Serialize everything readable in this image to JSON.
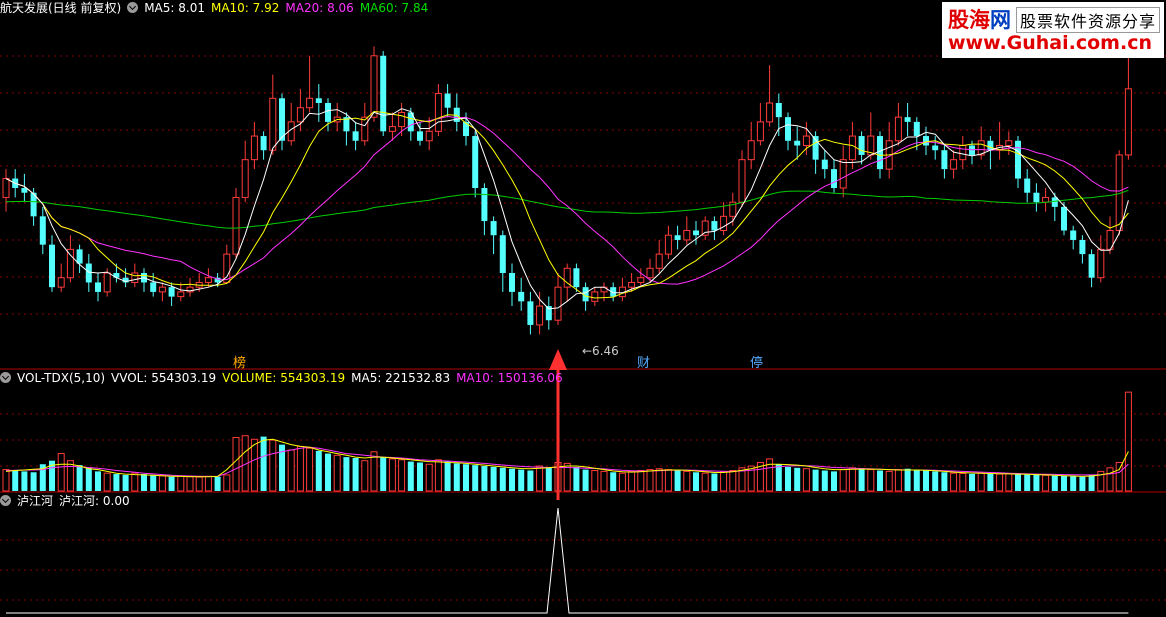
{
  "header_main": {
    "stock_title": "航天发展(日线 前复权)",
    "ma5": "MA5: 8.01",
    "ma10": "MA10: 7.92",
    "ma20": "MA20: 8.06",
    "ma60": "MA60: 7.84"
  },
  "header_volume": {
    "indicator": "VOL-TDX(5,10)",
    "vvol": "VVOL: 554303.19",
    "volume": "VOLUME: 554303.19",
    "ma5": "MA5: 221532.83",
    "ma10": "MA10: 150136.06"
  },
  "header_signal": {
    "indicator": "泸江河",
    "value": "泸江河: 0.00"
  },
  "logo": {
    "name_a": "股海",
    "name_b": "网",
    "slogan": "股票软件资源分享",
    "url": "www.Guhai.com.cn"
  },
  "markers": {
    "bang": "榜",
    "cai": "财",
    "ting": "停",
    "low_price": "←6.46"
  },
  "colors": {
    "up": "#ff3b3b",
    "down": "#54ffff",
    "ma5": "#ffffff",
    "ma10": "#ffff00",
    "ma20": "#ff33ff",
    "ma60": "#00cc00",
    "grid": "#880000",
    "arrow": "#ff3030"
  },
  "chart_data": [
    {
      "type": "candlestick",
      "title": "航天发展(日线 前复权)",
      "low_marker": 6.46,
      "series": [
        {
          "name": "MA5",
          "value": 8.01
        },
        {
          "name": "MA10",
          "value": 7.92
        },
        {
          "name": "MA20",
          "value": 8.06
        },
        {
          "name": "MA60",
          "value": 7.84
        }
      ],
      "candles": [
        [
          7.9,
          8.1,
          8.2,
          7.75
        ],
        [
          8.1,
          8.0,
          8.2,
          7.9
        ],
        [
          8.0,
          7.95,
          8.15,
          7.85
        ],
        [
          7.95,
          7.7,
          8.0,
          7.6
        ],
        [
          7.7,
          7.4,
          7.8,
          7.3
        ],
        [
          7.4,
          6.95,
          7.5,
          6.9
        ],
        [
          6.95,
          7.05,
          7.2,
          6.9
        ],
        [
          7.05,
          7.35,
          7.5,
          7.0
        ],
        [
          7.35,
          7.2,
          7.4,
          7.1
        ],
        [
          7.2,
          7.0,
          7.3,
          6.9
        ],
        [
          7.0,
          6.9,
          7.1,
          6.8
        ],
        [
          6.9,
          7.1,
          7.15,
          6.85
        ],
        [
          7.1,
          7.05,
          7.2,
          7.0
        ],
        [
          7.05,
          7.0,
          7.15,
          6.95
        ],
        [
          7.0,
          7.1,
          7.2,
          6.95
        ],
        [
          7.1,
          7.0,
          7.15,
          6.9
        ],
        [
          7.0,
          6.9,
          7.1,
          6.85
        ],
        [
          6.9,
          6.95,
          7.0,
          6.8
        ],
        [
          6.95,
          6.85,
          7.0,
          6.75
        ],
        [
          6.85,
          6.9,
          7.0,
          6.8
        ],
        [
          6.9,
          6.95,
          7.05,
          6.85
        ],
        [
          6.95,
          7.0,
          7.1,
          6.9
        ],
        [
          7.0,
          7.05,
          7.15,
          6.95
        ],
        [
          7.05,
          7.0,
          7.1,
          6.95
        ],
        [
          7.0,
          7.3,
          7.4,
          7.0
        ],
        [
          7.3,
          7.9,
          8.0,
          7.25
        ],
        [
          7.9,
          8.3,
          8.5,
          7.85
        ],
        [
          8.3,
          8.55,
          8.7,
          8.2
        ],
        [
          8.55,
          8.4,
          8.6,
          8.3
        ],
        [
          8.4,
          8.95,
          9.2,
          8.35
        ],
        [
          8.95,
          8.5,
          9.0,
          8.4
        ],
        [
          8.5,
          8.7,
          8.9,
          8.45
        ],
        [
          8.7,
          8.85,
          9.05,
          8.6
        ],
        [
          8.85,
          8.95,
          9.4,
          8.8
        ],
        [
          8.95,
          8.9,
          9.1,
          8.7
        ],
        [
          8.9,
          8.7,
          8.95,
          8.6
        ],
        [
          8.7,
          8.75,
          8.9,
          8.6
        ],
        [
          8.75,
          8.6,
          8.8,
          8.45
        ],
        [
          8.6,
          8.5,
          8.7,
          8.4
        ],
        [
          8.5,
          8.75,
          8.9,
          8.45
        ],
        [
          8.75,
          9.4,
          9.5,
          8.7
        ],
        [
          9.4,
          8.6,
          9.45,
          8.55
        ],
        [
          8.6,
          8.65,
          8.8,
          8.5
        ],
        [
          8.65,
          8.8,
          8.9,
          8.55
        ],
        [
          8.8,
          8.6,
          8.85,
          8.5
        ],
        [
          8.6,
          8.5,
          8.7,
          8.45
        ],
        [
          8.5,
          8.6,
          8.75,
          8.4
        ],
        [
          8.6,
          9.0,
          9.1,
          8.55
        ],
        [
          9.0,
          8.85,
          9.1,
          8.75
        ],
        [
          8.85,
          8.7,
          9.0,
          8.6
        ],
        [
          8.7,
          8.55,
          8.8,
          8.45
        ],
        [
          8.55,
          8.0,
          8.6,
          7.9
        ],
        [
          8.0,
          7.65,
          8.05,
          7.5
        ],
        [
          7.65,
          7.5,
          7.7,
          7.3
        ],
        [
          7.5,
          7.1,
          7.55,
          6.9
        ],
        [
          7.1,
          6.9,
          7.2,
          6.75
        ],
        [
          6.9,
          6.8,
          7.05,
          6.7
        ],
        [
          6.8,
          6.55,
          6.9,
          6.45
        ],
        [
          6.55,
          6.75,
          6.9,
          6.45
        ],
        [
          6.75,
          6.6,
          6.85,
          6.5
        ],
        [
          6.6,
          6.95,
          7.1,
          6.55
        ],
        [
          6.95,
          7.15,
          7.2,
          6.8
        ],
        [
          7.15,
          6.95,
          7.2,
          6.9
        ],
        [
          6.95,
          6.8,
          7.0,
          6.7
        ],
        [
          6.8,
          6.9,
          6.95,
          6.75
        ],
        [
          6.9,
          6.95,
          7.0,
          6.8
        ],
        [
          6.95,
          6.85,
          7.0,
          6.8
        ],
        [
          6.85,
          6.95,
          7.05,
          6.8
        ],
        [
          6.95,
          7.0,
          7.1,
          6.9
        ],
        [
          7.0,
          7.05,
          7.15,
          6.95
        ],
        [
          7.05,
          7.15,
          7.25,
          7.0
        ],
        [
          7.15,
          7.3,
          7.45,
          7.1
        ],
        [
          7.3,
          7.5,
          7.6,
          7.25
        ],
        [
          7.5,
          7.45,
          7.6,
          7.35
        ],
        [
          7.45,
          7.55,
          7.7,
          7.4
        ],
        [
          7.55,
          7.5,
          7.65,
          7.4
        ],
        [
          7.5,
          7.65,
          7.7,
          7.45
        ],
        [
          7.65,
          7.55,
          7.7,
          7.45
        ],
        [
          7.55,
          7.7,
          7.85,
          7.5
        ],
        [
          7.7,
          7.85,
          7.95,
          7.6
        ],
        [
          7.85,
          8.3,
          8.4,
          7.8
        ],
        [
          8.3,
          8.5,
          8.7,
          8.2
        ],
        [
          8.5,
          8.7,
          8.9,
          8.45
        ],
        [
          8.7,
          8.9,
          9.3,
          8.65
        ],
        [
          8.9,
          8.75,
          9.0,
          8.55
        ],
        [
          8.75,
          8.5,
          8.8,
          8.4
        ],
        [
          8.5,
          8.45,
          8.65,
          8.3
        ],
        [
          8.45,
          8.55,
          8.7,
          8.35
        ],
        [
          8.55,
          8.3,
          8.6,
          8.15
        ],
        [
          8.3,
          8.2,
          8.4,
          8.1
        ],
        [
          8.2,
          8.0,
          8.3,
          7.95
        ],
        [
          8.0,
          8.3,
          8.45,
          7.9
        ],
        [
          8.3,
          8.55,
          8.7,
          8.2
        ],
        [
          8.55,
          8.35,
          8.6,
          8.25
        ],
        [
          8.35,
          8.55,
          8.8,
          8.3
        ],
        [
          8.55,
          8.2,
          8.6,
          8.1
        ],
        [
          8.2,
          8.5,
          8.7,
          8.1
        ],
        [
          8.5,
          8.75,
          8.9,
          8.45
        ],
        [
          8.75,
          8.7,
          8.9,
          8.55
        ],
        [
          8.7,
          8.55,
          8.75,
          8.4
        ],
        [
          8.55,
          8.45,
          8.65,
          8.35
        ],
        [
          8.45,
          8.4,
          8.55,
          8.3
        ],
        [
          8.4,
          8.2,
          8.45,
          8.1
        ],
        [
          8.2,
          8.3,
          8.4,
          8.1
        ],
        [
          8.3,
          8.45,
          8.55,
          8.2
        ],
        [
          8.45,
          8.35,
          8.5,
          8.25
        ],
        [
          8.35,
          8.5,
          8.65,
          8.3
        ],
        [
          8.5,
          8.4,
          8.55,
          8.2
        ],
        [
          8.4,
          8.45,
          8.7,
          8.3
        ],
        [
          8.45,
          8.5,
          8.6,
          8.35
        ],
        [
          8.5,
          8.1,
          8.55,
          8.0
        ],
        [
          8.1,
          7.95,
          8.2,
          7.85
        ],
        [
          7.95,
          7.85,
          8.05,
          7.75
        ],
        [
          7.85,
          7.9,
          8.0,
          7.75
        ],
        [
          7.9,
          7.8,
          7.95,
          7.65
        ],
        [
          7.8,
          7.55,
          7.85,
          7.5
        ],
        [
          7.55,
          7.45,
          7.6,
          7.35
        ],
        [
          7.45,
          7.3,
          7.5,
          7.2
        ],
        [
          7.3,
          7.05,
          7.35,
          6.95
        ],
        [
          7.05,
          7.35,
          7.5,
          7.0
        ],
        [
          7.35,
          7.55,
          7.7,
          7.3
        ],
        [
          7.55,
          8.35,
          8.4,
          7.5
        ],
        [
          8.35,
          9.05,
          9.6,
          8.3
        ]
      ]
    },
    {
      "type": "bar",
      "title": "VOL-TDX(5,10)",
      "series": [
        {
          "name": "VVOL",
          "value": 554303.19
        },
        {
          "name": "VOLUME",
          "value": 554303.19
        },
        {
          "name": "MA5",
          "value": 221532.83
        },
        {
          "name": "MA10",
          "value": 150136.06
        }
      ],
      "ylim": [
        0,
        600000
      ],
      "values": [
        120000,
        115000,
        110000,
        105000,
        150000,
        170000,
        210000,
        170000,
        145000,
        130000,
        110000,
        100000,
        95000,
        90000,
        100000,
        95000,
        90000,
        85000,
        80000,
        85000,
        80000,
        78000,
        82000,
        80000,
        90000,
        300000,
        310000,
        290000,
        305000,
        285000,
        260000,
        230000,
        250000,
        240000,
        225000,
        210000,
        200000,
        190000,
        185000,
        170000,
        220000,
        190000,
        180000,
        175000,
        165000,
        160000,
        150000,
        175000,
        165000,
        155000,
        150000,
        145000,
        140000,
        135000,
        130000,
        125000,
        120000,
        115000,
        140000,
        135000,
        160000,
        155000,
        135000,
        120000,
        115000,
        110000,
        105000,
        100000,
        110000,
        115000,
        120000,
        125000,
        120000,
        115000,
        110000,
        105000,
        100000,
        98000,
        110000,
        115000,
        130000,
        140000,
        160000,
        180000,
        150000,
        135000,
        130000,
        125000,
        120000,
        115000,
        110000,
        120000,
        130000,
        125000,
        120000,
        115000,
        110000,
        120000,
        125000,
        120000,
        115000,
        110000,
        105000,
        100000,
        98000,
        96000,
        100000,
        98000,
        95000,
        97000,
        95000,
        92000,
        90000,
        88000,
        86000,
        84000,
        82000,
        80000,
        90000,
        110000,
        130000,
        160000,
        554303
      ],
      "ma5": [
        110000,
        115000,
        118000,
        122000,
        125000,
        145000,
        150000,
        150000,
        140000,
        125000,
        120000,
        110000,
        100000,
        95000,
        92000,
        90000,
        88000,
        85000,
        83000,
        82000,
        81000,
        80000,
        80000,
        82000,
        120000,
        170000,
        220000,
        260000,
        285000,
        290000,
        275000,
        260000,
        250000,
        245000,
        230000,
        220000,
        210000,
        200000,
        190000,
        185000,
        190000,
        190000,
        185000,
        180000,
        175000,
        170000,
        165000,
        163000,
        160000,
        158000,
        155000,
        150000,
        145000,
        140000,
        135000,
        130000,
        126000,
        125000,
        128000,
        130000,
        135000,
        140000,
        140000,
        135000,
        128000,
        120000,
        112000,
        108000,
        106000,
        108000,
        112000,
        116000,
        118000,
        118000,
        116000,
        112000,
        108000,
        104000,
        104000,
        108000,
        116000,
        125000,
        138000,
        150000,
        150000,
        148000,
        145000,
        140000,
        132000,
        125000,
        120000,
        120000,
        122000,
        123000,
        123000,
        122000,
        120000,
        118000,
        118000,
        118000,
        116000,
        114000,
        110000,
        106000,
        103000,
        101000,
        99000,
        98000,
        97000,
        96000,
        95000,
        94000,
        92000,
        90000,
        88000,
        86000,
        84000,
        82000,
        84000,
        90000,
        100000,
        120000,
        221533
      ],
      "ma10": [
        115000,
        116000,
        117000,
        118000,
        120000,
        130000,
        135000,
        138000,
        136000,
        132000,
        128000,
        122000,
        115000,
        110000,
        105000,
        100000,
        96000,
        92000,
        88000,
        86000,
        84000,
        83000,
        82000,
        82000,
        100000,
        125000,
        150000,
        175000,
        195000,
        210000,
        220000,
        230000,
        240000,
        245000,
        240000,
        230000,
        220000,
        210000,
        205000,
        200000,
        195000,
        190000,
        188000,
        185000,
        180000,
        175000,
        172000,
        170000,
        168000,
        165000,
        162000,
        158000,
        155000,
        150000,
        146000,
        142000,
        138000,
        135000,
        133000,
        132000,
        132000,
        132000,
        130000,
        128000,
        126000,
        124000,
        120000,
        116000,
        114000,
        112000,
        112000,
        114000,
        116000,
        117000,
        117000,
        116000,
        114000,
        112000,
        110000,
        110000,
        112000,
        116000,
        122000,
        130000,
        136000,
        140000,
        142000,
        142000,
        140000,
        136000,
        132000,
        130000,
        128000,
        126000,
        124000,
        122000,
        120000,
        119000,
        118000,
        118000,
        117000,
        116000,
        114000,
        112000,
        110000,
        108000,
        106000,
        104000,
        102000,
        100000,
        98000,
        96000,
        95000,
        94000,
        93000,
        92000,
        91000,
        90000,
        90000,
        92000,
        96000,
        104000,
        150136
      ]
    },
    {
      "type": "line",
      "title": "泸江河",
      "series": [
        {
          "name": "泸江河",
          "value": 0.0
        }
      ],
      "signal_index": 60
    }
  ]
}
